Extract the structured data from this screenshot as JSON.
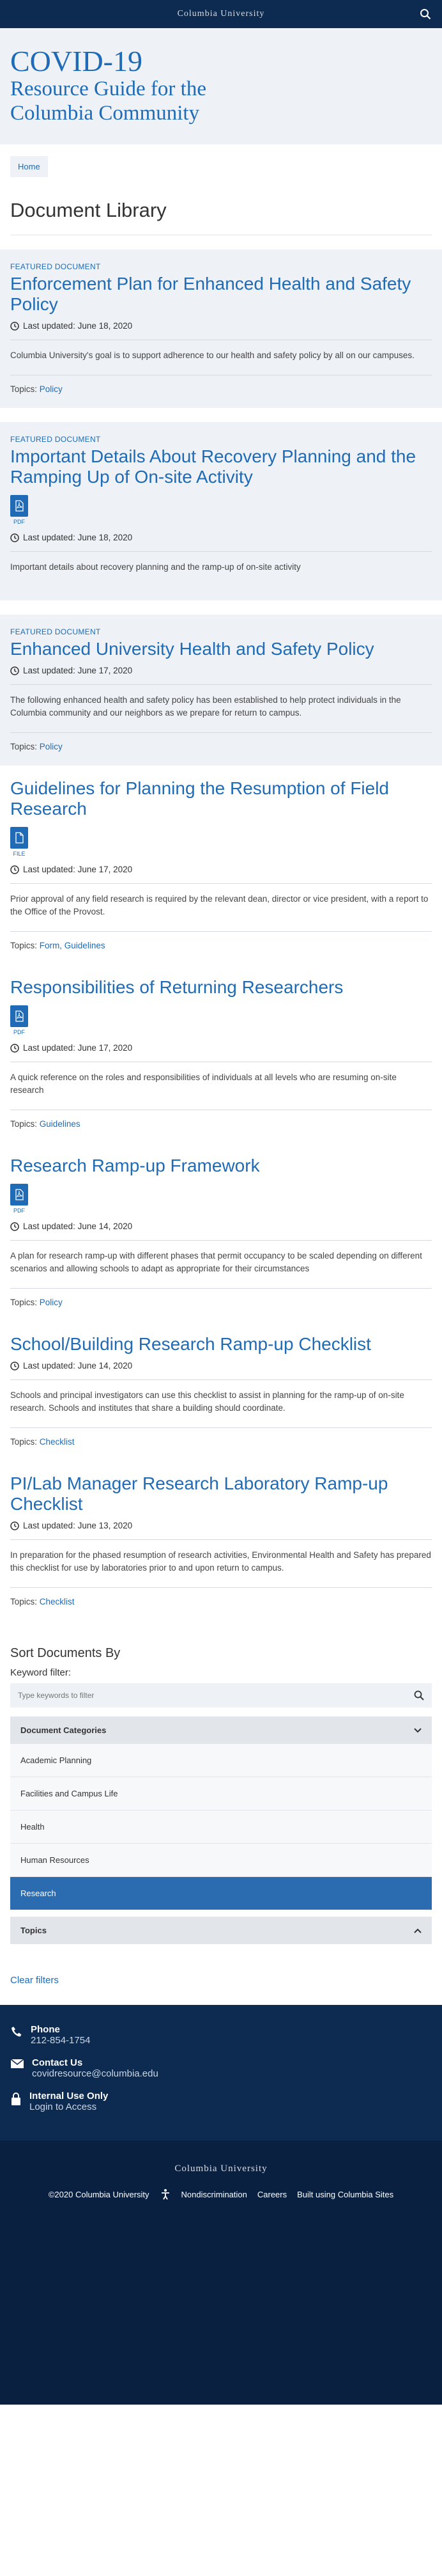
{
  "topbar": {
    "brand": "Columbia University"
  },
  "hero": {
    "line1": "COVID-19",
    "line2": "Resource Guide for the",
    "line3": "Columbia Community"
  },
  "breadcrumb": {
    "home": "Home"
  },
  "library_title": "Document Library",
  "documents": [
    {
      "kicker": "Featured Document",
      "title": "Enforcement Plan for Enhanced Health and Safety Policy",
      "updated": "Last updated: June 18, 2020",
      "description": "Columbia University's goal is to support adherence to our health and safety policy by all on our campuses.",
      "topics_label": "Topics:",
      "topics": "Policy"
    },
    {
      "kicker": "Featured Document",
      "title": "Important Details About Recovery Planning and the Ramping Up of On-site Activity",
      "file_type": "PDF",
      "updated": "Last updated: June 18, 2020",
      "description": "Important details about recovery planning and the ramp-up of on-site activity"
    },
    {
      "kicker": "Featured Document",
      "title": "Enhanced University Health and Safety Policy",
      "updated": "Last updated: June 17, 2020",
      "description": "The following enhanced health and safety policy has been established to help protect individuals in the Columbia community and our neighbors as we prepare for return to campus.",
      "topics_label": "Topics:",
      "topics": "Policy"
    },
    {
      "title": "Guidelines for Planning the Resumption of Field Research",
      "file_type": "FILE",
      "updated": "Last updated: June 17, 2020",
      "description": "Prior approval of any field research is required by the relevant dean, director or vice president, with a report to the Office of the Provost.",
      "topics_label": "Topics:",
      "topics": "Form, Guidelines"
    },
    {
      "title": "Responsibilities of Returning Researchers",
      "file_type": "PDF",
      "updated": "Last updated: June 17, 2020",
      "description": "A quick reference on the roles and responsibilities of individuals at all levels who are resuming on-site research",
      "topics_label": "Topics:",
      "topics": "Guidelines"
    },
    {
      "title": "Research Ramp-up Framework",
      "file_type": "PDF",
      "updated": "Last updated: June 14, 2020",
      "description": "A plan for research ramp-up with different phases that permit occupancy to be scaled depending on different scenarios and allowing schools to adapt as appropriate for their circumstances",
      "topics_label": "Topics:",
      "topics": "Policy"
    },
    {
      "title": "School/Building Research Ramp-up Checklist",
      "updated": "Last updated: June 14, 2020",
      "description": "Schools and principal investigators can use this checklist to assist in planning for the ramp-up of on-site research. Schools and institutes that share a building should coordinate.",
      "topics_label": "Topics:",
      "topics": "Checklist"
    },
    {
      "title": "PI/Lab Manager Research Laboratory Ramp-up Checklist",
      "updated": "Last updated: June 13, 2020",
      "description": "In preparation for the phased resumption of research activities, Environmental Health and Safety has prepared this checklist for use by laboratories prior to and upon return to campus.",
      "topics_label": "Topics:",
      "topics": "Checklist"
    }
  ],
  "sort": {
    "heading": "Sort Documents By",
    "keyword_label": "Keyword filter:",
    "keyword_placeholder": "Type keywords to filter",
    "categories_heading": "Document Categories",
    "categories": [
      "Academic Planning",
      "Facilities and Campus Life",
      "Health",
      "Human Resources",
      "Research"
    ],
    "topics_heading": "Topics",
    "clear": "Clear filters"
  },
  "contact": {
    "phone_label": "Phone",
    "phone": "212-854-1754",
    "email_label": "Contact Us",
    "email": "covidresource@columbia.edu",
    "internal_label": "Internal Use Only",
    "login": "Login to Access"
  },
  "footer": {
    "brand": "Columbia University",
    "copyright": "©2020 Columbia University",
    "nondiscrimination": "Nondiscrimination",
    "careers": "Careers",
    "built": "Built using Columbia Sites"
  },
  "colors": {
    "brand_blue": "#1f6bb5",
    "navy": "#0d2a50",
    "light_bg": "#eef1f5",
    "active_category": "#2b6cb0"
  }
}
